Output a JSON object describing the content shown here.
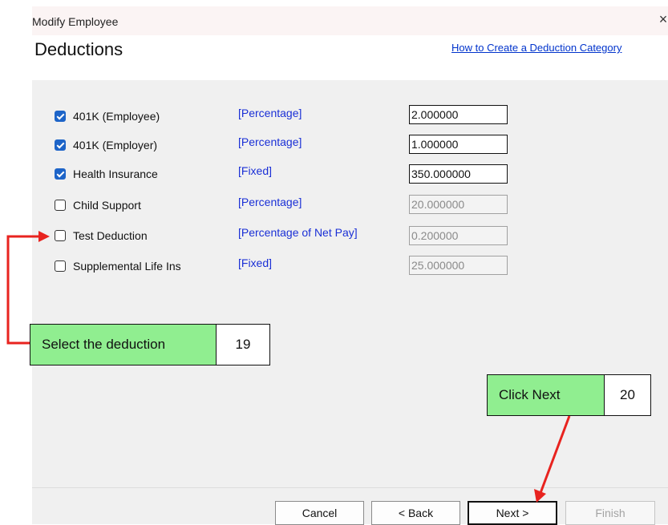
{
  "window": {
    "title": "Modify Employee",
    "close_glyph": "×"
  },
  "page": {
    "title": "Deductions",
    "help_link": "How to Create a Deduction Category"
  },
  "deductions": [
    {
      "label": "401K (Employee)",
      "type": "[Percentage]",
      "value": "2.000000",
      "checked": true
    },
    {
      "label": "401K (Employer)",
      "type": "[Percentage]",
      "value": "1.000000",
      "checked": true
    },
    {
      "label": "Health Insurance",
      "type": "[Fixed]",
      "value": "350.000000",
      "checked": true
    },
    {
      "label": "Child Support",
      "type": "[Percentage]",
      "value": "20.000000",
      "checked": false
    },
    {
      "label": "Test Deduction",
      "type": "[Percentage of Net Pay]",
      "value": "0.200000",
      "checked": false
    },
    {
      "label": "Supplemental Life Ins",
      "type": "[Fixed]",
      "value": "25.000000",
      "checked": false
    }
  ],
  "buttons": {
    "cancel": "Cancel",
    "back": "< Back",
    "next": "Next >",
    "finish": "Finish"
  },
  "callouts": [
    {
      "text": "Select the deduction",
      "step": "19"
    },
    {
      "text": "Click Next",
      "step": "20"
    }
  ],
  "colors": {
    "callout_fill": "#90ee90",
    "arrow": "#e8231f",
    "checkbox_checked": "#1d64c8",
    "type_text": "#1a2fd6",
    "link": "#0033cc"
  },
  "icons": {
    "close": "close-icon",
    "checkbox": "checkbox-icon",
    "arrow": "arrow-icon"
  }
}
